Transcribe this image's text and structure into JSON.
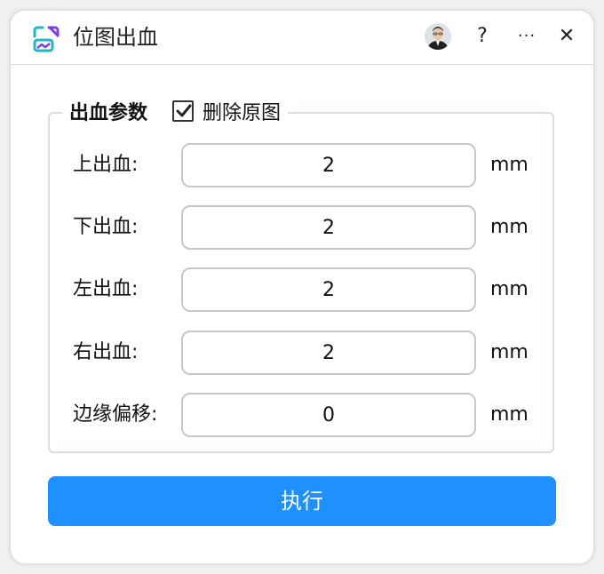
{
  "window": {
    "title": "位图出血"
  },
  "titlebar": {
    "help_label": "?",
    "more_label": "···",
    "close_label": "✕"
  },
  "group": {
    "title": "出血参数",
    "delete_original": {
      "label": "删除原图",
      "checked": true
    }
  },
  "fields": [
    {
      "label": "上出血:",
      "value": "2",
      "unit": "mm"
    },
    {
      "label": "下出血:",
      "value": "2",
      "unit": "mm"
    },
    {
      "label": "左出血:",
      "value": "2",
      "unit": "mm"
    },
    {
      "label": "右出血:",
      "value": "2",
      "unit": "mm"
    },
    {
      "label": "边缘偏移:",
      "value": "0",
      "unit": "mm"
    }
  ],
  "actions": {
    "execute_label": "执行"
  },
  "colors": {
    "primary": "#1e90ff",
    "icon_purple": "#7b3fe4",
    "icon_teal": "#1fb6c9"
  }
}
